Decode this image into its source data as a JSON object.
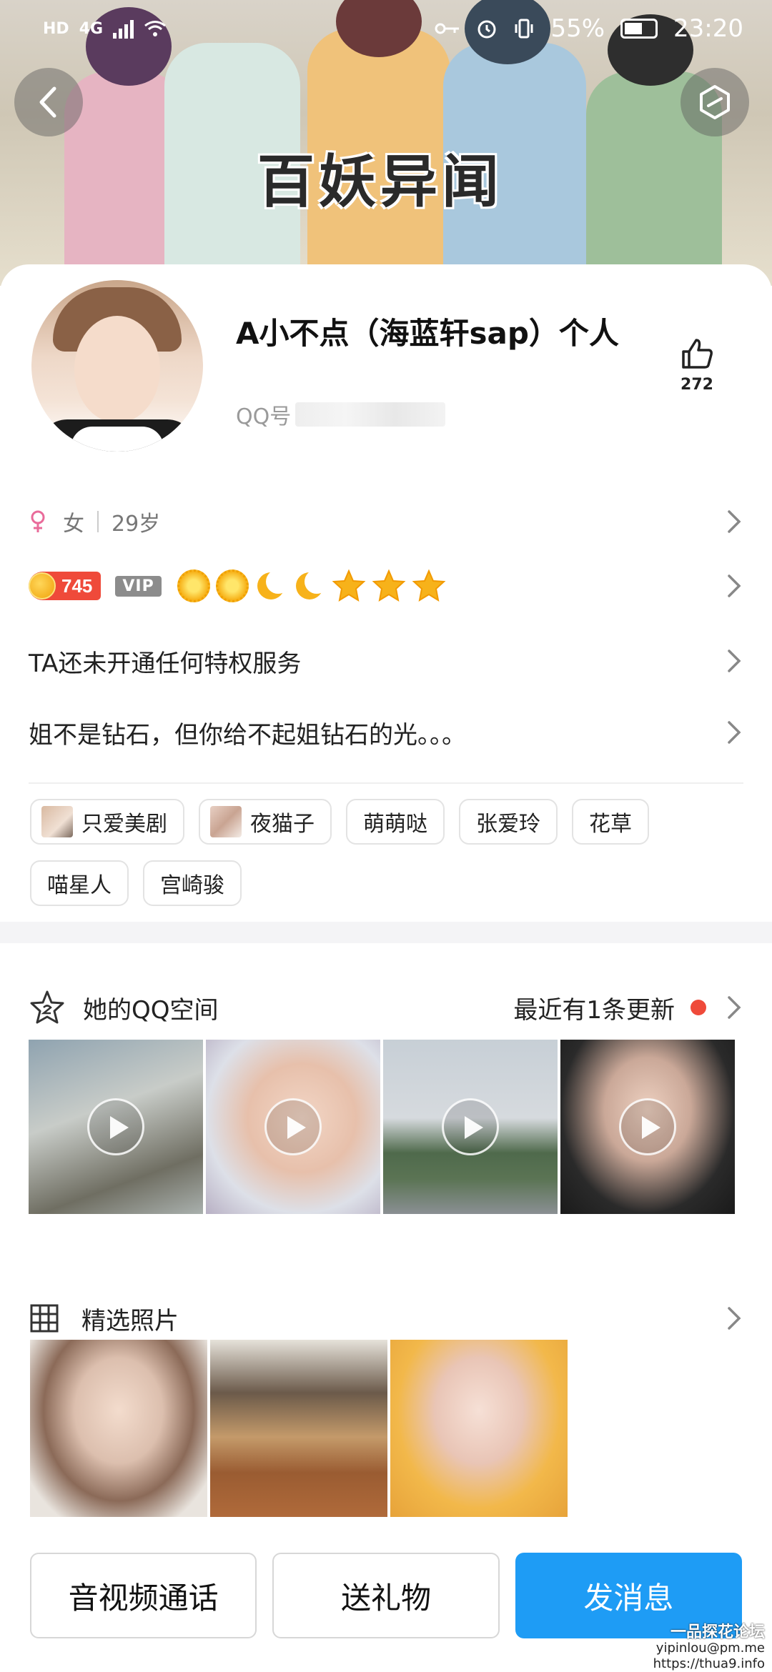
{
  "status_bar": {
    "left_labels": [
      "HD",
      "4G"
    ],
    "battery": "55%",
    "time": "23:20"
  },
  "banner": {
    "title": "百妖异闻"
  },
  "profile": {
    "nickname": "A小不点（海蓝轩sap）个人",
    "qq_label": "QQ号",
    "likes": "272",
    "gender": "女",
    "age": "29岁",
    "level_score": "745",
    "vip_label": "VIP",
    "level_icons": [
      "sun",
      "sun",
      "moon",
      "moon",
      "star",
      "star",
      "star"
    ],
    "privilege_text": "TA还未开通任何特权服务",
    "signature": "姐不是钻石，但你给不起姐钻石的光。。。"
  },
  "tags": [
    {
      "label": "只爱美剧",
      "has_thumb": true
    },
    {
      "label": "夜猫子",
      "has_thumb": true
    },
    {
      "label": "萌萌哒",
      "has_thumb": false
    },
    {
      "label": "张爱玲",
      "has_thumb": false
    },
    {
      "label": "花草",
      "has_thumb": false
    },
    {
      "label": "喵星人",
      "has_thumb": false
    },
    {
      "label": "宫崎骏",
      "has_thumb": false
    }
  ],
  "qzone": {
    "title": "她的QQ空间",
    "update_text": "最近有1条更新"
  },
  "photos": {
    "title": "精选照片"
  },
  "actions": {
    "call": "音视频通话",
    "gift": "送礼物",
    "message": "发消息"
  },
  "watermark": {
    "title": "一品探花论坛",
    "email": "yipinlou@pm.me",
    "url": "https://thua9.info"
  },
  "colors": {
    "accent_blue": "#1e9cf5",
    "badge_red": "#ef4a3a",
    "gender_pink": "#e96b9a"
  }
}
